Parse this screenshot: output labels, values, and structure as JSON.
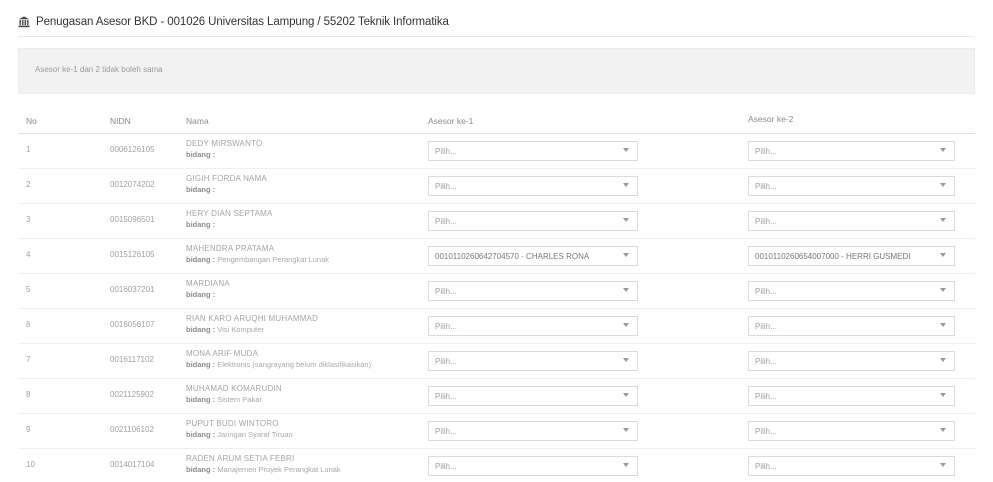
{
  "header": {
    "title": "Penugasan Asesor BKD - 001026 Universitas Lampung / 55202 Teknik Informatika",
    "icon": "institution-icon"
  },
  "notice": {
    "text": "Asesor ke-1 dan 2 tidak boleh sama"
  },
  "columns": {
    "no": "No",
    "nidn": "NIDN",
    "nama": "Nama",
    "asesor1": "Asesor ke-1",
    "asesor2": "Asesor ke-2"
  },
  "rows": [
    {
      "no": "1",
      "nidn": "0006126105",
      "nama": "DEDY MIRSWANTO",
      "bidang_label": "bidang :",
      "bidang": "",
      "asesor1": "Pilih...",
      "asesor2": "Pilih..."
    },
    {
      "no": "2",
      "nidn": "0012074202",
      "nama": "GIGIH FORDA NAMA",
      "bidang_label": "bidang :",
      "bidang": "",
      "asesor1": "Pilih...",
      "asesor2": "Pilih..."
    },
    {
      "no": "3",
      "nidn": "0015096501",
      "nama": "HERY DIAN SEPTAMA",
      "bidang_label": "bidang :",
      "bidang": "",
      "asesor1": "Pilih...",
      "asesor2": "Pilih..."
    },
    {
      "no": "4",
      "nidn": "0015126105",
      "nama": "MAHENDRA PRATAMA",
      "bidang_label": "bidang :",
      "bidang": "Pengembangan Perangkat Lunak",
      "asesor1": "0010110260642704570 - CHARLES RONA",
      "asesor2": "0010110260654007000 - HERRI GUSMEDI"
    },
    {
      "no": "5",
      "nidn": "0016037201",
      "nama": "MARDIANA",
      "bidang_label": "bidang :",
      "bidang": "",
      "asesor1": "Pilih...",
      "asesor2": "Pilih..."
    },
    {
      "no": "6",
      "nidn": "0016056107",
      "nama": "RIAN KARO ARUQHI MUHAMMAD",
      "bidang_label": "bidang :",
      "bidang": "Visi Komputer",
      "asesor1": "Pilih...",
      "asesor2": "Pilih..."
    },
    {
      "no": "7",
      "nidn": "0016117102",
      "nama": "MONA ARIF MUDA",
      "bidang_label": "bidang :",
      "bidang": "Elektronis (sangrayang belum diklasifikasikan)",
      "asesor1": "Pilih...",
      "asesor2": "Pilih..."
    },
    {
      "no": "8",
      "nidn": "0021125902",
      "nama": "MUHAMAD KOMARUDIN",
      "bidang_label": "bidang :",
      "bidang": "Sistem Pakar",
      "asesor1": "Pilih...",
      "asesor2": "Pilih..."
    },
    {
      "no": "9",
      "nidn": "0021106102",
      "nama": "PUPUT BUDI WINTORO",
      "bidang_label": "bidang :",
      "bidang": "Jaringan Syaraf Tiruan",
      "asesor1": "Pilih...",
      "asesor2": "Pilih..."
    },
    {
      "no": "10",
      "nidn": "0014017104",
      "nama": "RADEN ARUM SETIA FEBRI",
      "bidang_label": "bidang :",
      "bidang": "Manajemen Proyek Perangkat Lunak",
      "asesor1": "Pilih...",
      "asesor2": "Pilih..."
    }
  ]
}
